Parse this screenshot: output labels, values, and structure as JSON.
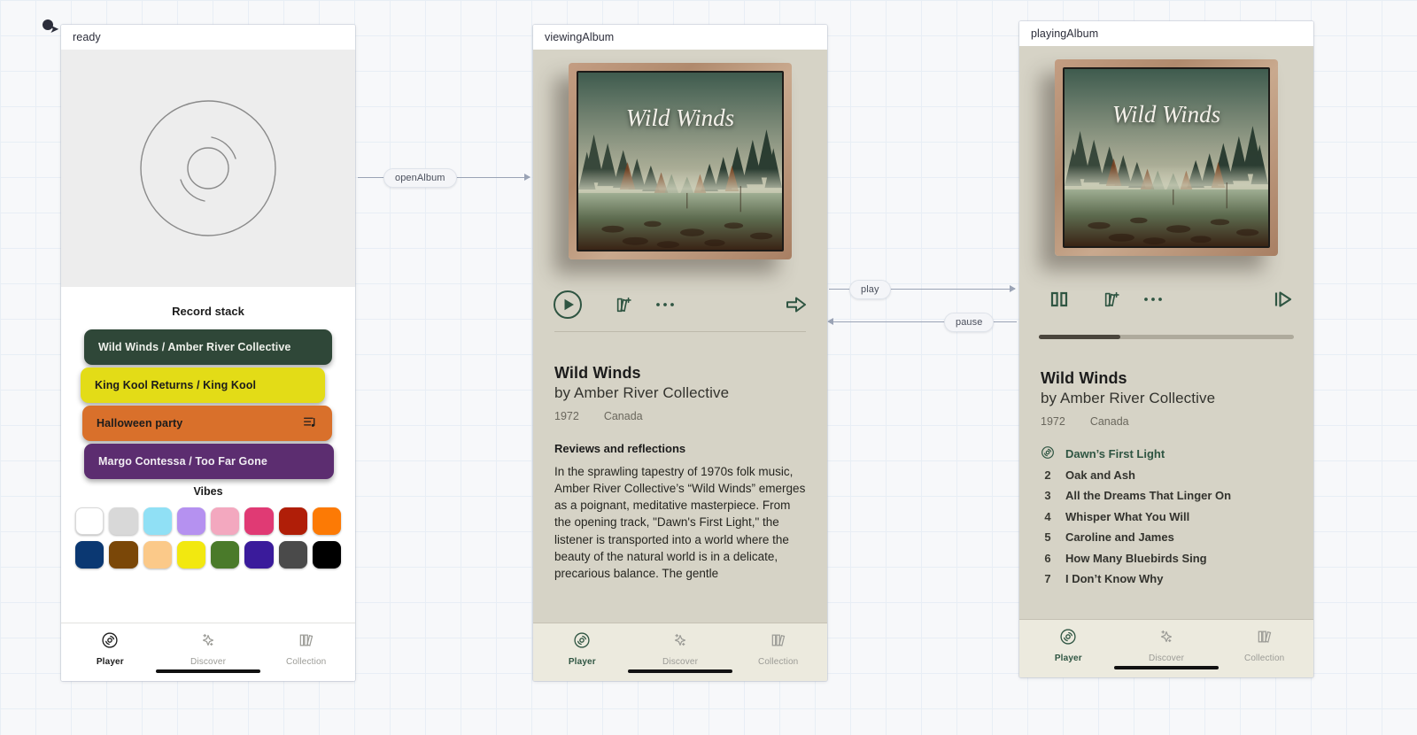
{
  "flow": {
    "edges": [
      {
        "label": "openAlbum"
      },
      {
        "label": "play"
      },
      {
        "label": "pause"
      }
    ]
  },
  "nodes": {
    "ready": {
      "title": "ready",
      "record_stack_title": "Record stack",
      "records": [
        {
          "label": "Wild Winds  /  Amber River Collective",
          "color": "#2f4738",
          "text_color": "#eef0ea",
          "icon": ""
        },
        {
          "label": "King Kool Returns  /  King Kool",
          "color": "#e3dc17",
          "text_color": "#1c1c1c",
          "icon": ""
        },
        {
          "label": "Halloween party",
          "color": "#d9702b",
          "text_color": "#1c1c1c",
          "icon": "playlist-icon"
        },
        {
          "label": "Margo Contessa  /  Too Far Gone",
          "color": "#5c2d70",
          "text_color": "#f0ecf2",
          "icon": ""
        }
      ],
      "vibes_title": "Vibes",
      "vibes": [
        "#ffffff",
        "#d8d8d8",
        "#90e0f5",
        "#b591f0",
        "#f3a8bf",
        "#e03a74",
        "#b01e08",
        "#fc7a05",
        "#0b3872",
        "#7a4708",
        "#fbc989",
        "#f2e810",
        "#4a7a2a",
        "#3a1b9b",
        "#4a4a4a",
        "#000000"
      ],
      "tabs": [
        {
          "label": "Player",
          "icon": "record-icon",
          "active": true
        },
        {
          "label": "Discover",
          "icon": "sparkle-icon",
          "active": false
        },
        {
          "label": "Collection",
          "icon": "books-icon",
          "active": false
        }
      ]
    },
    "viewingAlbum": {
      "title": "viewingAlbum",
      "cover_title": "Wild Winds",
      "controls": [
        {
          "name": "play-button",
          "icon": "play-circle-icon"
        },
        {
          "name": "add-to-collection-button",
          "icon": "book-plus-icon"
        },
        {
          "name": "more-options-button",
          "icon": "ellipsis-icon"
        },
        {
          "name": "next-button",
          "icon": "arrow-right-icon"
        }
      ],
      "album_name": "Wild Winds",
      "artist_name": "by Amber River Collective",
      "year": "1972",
      "country": "Canada",
      "reviews_title": "Reviews and reflections",
      "reviews_body": "In the sprawling tapestry of 1970s folk music, Amber River Collective’s “Wild Winds” emerges as a poignant, meditative masterpiece. From the opening track, \"Dawn's First Light,\" the listener is transported into a world where the beauty of the natural world is in a delicate, precarious balance. The gentle",
      "tabs": [
        {
          "label": "Player",
          "icon": "record-icon",
          "active": true
        },
        {
          "label": "Discover",
          "icon": "sparkle-icon",
          "active": false
        },
        {
          "label": "Collection",
          "icon": "books-icon",
          "active": false
        }
      ]
    },
    "playingAlbum": {
      "title": "playingAlbum",
      "cover_title": "Wild Winds",
      "controls": [
        {
          "name": "pause-button",
          "icon": "pause-icon"
        },
        {
          "name": "add-to-collection-button",
          "icon": "book-plus-icon"
        },
        {
          "name": "more-options-button",
          "icon": "ellipsis-icon"
        },
        {
          "name": "skip-next-button",
          "icon": "skip-next-icon"
        }
      ],
      "progress_percent": 32,
      "album_name": "Wild Winds",
      "artist_name": "by Amber River Collective",
      "year": "1972",
      "country": "Canada",
      "tracks": [
        {
          "num": "",
          "name": "Dawn’s First Light",
          "playing": true
        },
        {
          "num": "2",
          "name": "Oak and Ash",
          "playing": false
        },
        {
          "num": "3",
          "name": "All the Dreams That Linger On",
          "playing": false
        },
        {
          "num": "4",
          "name": "Whisper What You Will",
          "playing": false
        },
        {
          "num": "5",
          "name": "Caroline and James",
          "playing": false
        },
        {
          "num": "6",
          "name": "How Many Bluebirds Sing",
          "playing": false
        },
        {
          "num": "7",
          "name": "I Don’t Know Why",
          "playing": false
        }
      ],
      "tabs": [
        {
          "label": "Player",
          "icon": "record-icon",
          "active": true
        },
        {
          "label": "Discover",
          "icon": "sparkle-icon",
          "active": false
        },
        {
          "label": "Collection",
          "icon": "books-icon",
          "active": false
        }
      ]
    }
  },
  "colors": {
    "accent_green": "#2f5542",
    "album_bg": "#d6d3c6",
    "tabbar_bg": "#eceade"
  }
}
